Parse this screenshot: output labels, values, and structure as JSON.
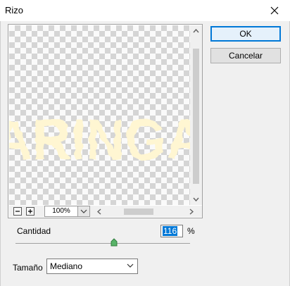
{
  "window": {
    "title": "Rizo"
  },
  "icons": {
    "close": "close-icon",
    "zoom_out": "minus-icon",
    "zoom_in": "plus-icon",
    "zoom_dropdown": "chevron-down-icon",
    "scroll_up": "arrow-up-icon",
    "scroll_down": "arrow-down-icon",
    "scroll_left": "arrow-left-icon",
    "scroll_right": "arrow-right-icon",
    "size_dropdown": "chevron-down-icon"
  },
  "preview": {
    "zoom": "100%",
    "art_text": "ARINGA",
    "art_color": "#fff6d2",
    "vertical_scroll_position": 0.2,
    "horizontal_scroll_position": 0.55
  },
  "buttons": {
    "ok": "OK",
    "cancel": "Cancelar"
  },
  "amount": {
    "label": "Cantidad",
    "value": "116",
    "unit": "%",
    "slider_fraction": 0.58
  },
  "size": {
    "label": "Tamaño",
    "selected": "Mediano"
  },
  "colors": {
    "accent": "#0078d7",
    "dialog_bg": "#f0f0f0",
    "checker": "#d5d5d5"
  }
}
